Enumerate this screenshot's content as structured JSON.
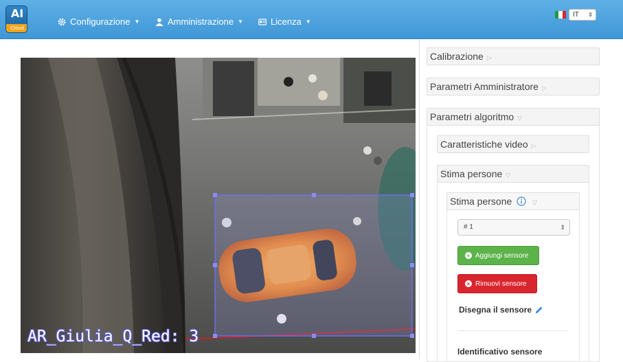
{
  "app": {
    "logo_text": "AI",
    "logo_sub": "Cloud"
  },
  "nav": {
    "items": [
      {
        "label": "Configurazione",
        "icon": "gear-icon"
      },
      {
        "label": "Amministrazione",
        "icon": "user-icon"
      },
      {
        "label": "Licenza",
        "icon": "license-icon"
      }
    ],
    "language": {
      "value": "IT"
    }
  },
  "camera": {
    "overlay_label": "AR_Giulia_Q_Red: 3"
  },
  "panel": {
    "sections": {
      "calibrazione": "Calibrazione",
      "parametri_amministratore": "Parametri Amministratore",
      "parametri_algoritmo": "Parametri algoritmo",
      "caratteristiche_video": "Caratteristiche video",
      "stima_persone_outer": "Stima persone",
      "stima_persone_inner": "Stima persone"
    },
    "sensor_select": {
      "value": "# 1"
    },
    "add_button": "Aggiungi sensore",
    "remove_button": "Rimuovi sensore",
    "draw_label": "Disegna il sensore",
    "identifier_label": "Identificativo sensore"
  },
  "colors": {
    "navbar": "#4ca3de",
    "add": "#5cb34a",
    "remove": "#d9262e",
    "roi": "#6c6cf0"
  }
}
